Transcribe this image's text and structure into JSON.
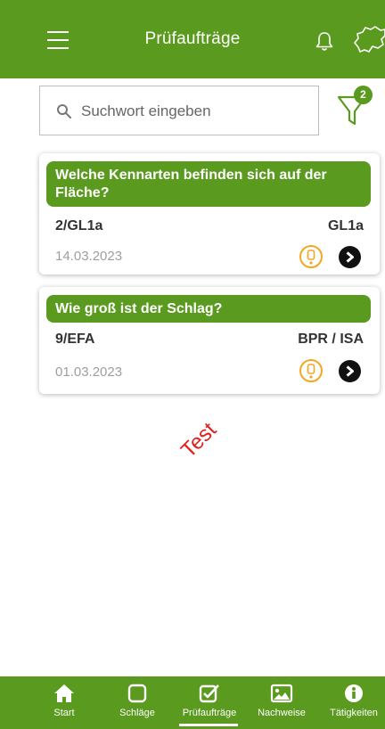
{
  "header": {
    "title": "Prüfaufträge"
  },
  "search": {
    "placeholder": "Suchwort eingeben"
  },
  "filter": {
    "badge_count": "2"
  },
  "cards": [
    {
      "question": "Welche Kennarten befinden sich auf der Fläche?",
      "id": "2/GL1a",
      "code": "GL1a",
      "date": "14.03.2023"
    },
    {
      "question": "Wie groß ist der Schlag?",
      "id": "9/EFA",
      "code": "BPR / ISA",
      "date": "01.03.2023"
    }
  ],
  "watermark": "Test",
  "bottom_nav": {
    "items": [
      {
        "label": "Start",
        "icon": "home-icon"
      },
      {
        "label": "Schläge",
        "icon": "square-icon"
      },
      {
        "label": "Prüfaufträge",
        "icon": "checkbox-icon",
        "active": true
      },
      {
        "label": "Nachweise",
        "icon": "image-icon"
      },
      {
        "label": "Tätigkeiten",
        "icon": "info-icon"
      }
    ]
  },
  "colors": {
    "primary": "#5a9a1e",
    "warning": "#f5a623",
    "watermark": "#e02020"
  }
}
